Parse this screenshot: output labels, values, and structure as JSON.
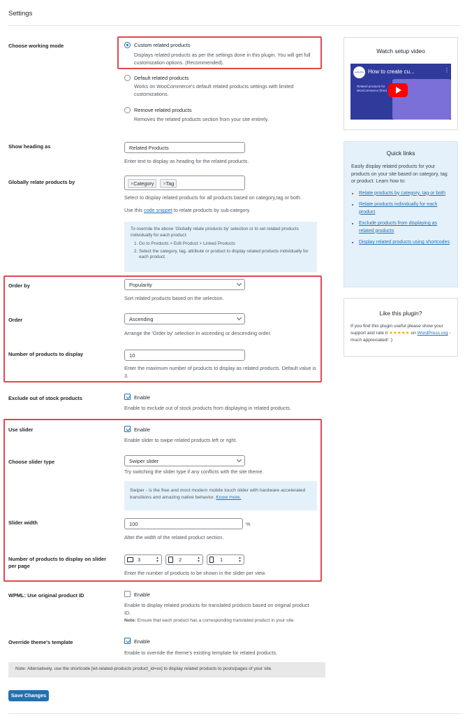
{
  "page": {
    "title": "Settings"
  },
  "working_mode": {
    "label": "Choose working mode",
    "options": [
      {
        "label": "Custom related products",
        "desc": "Displays related products as per the settings done in this plugin. You will get full customization options. (Recommended).",
        "selected": true
      },
      {
        "label": "Default related products",
        "desc": "Works on WooCommerce's default related products settings with limited customizations.",
        "selected": false
      },
      {
        "label": "Remove related products",
        "desc": "Removes the related products section from your site entirely.",
        "selected": false
      }
    ]
  },
  "heading": {
    "label": "Show heading as",
    "value": "Related Products",
    "desc": "Enter text to display as heading for the related products."
  },
  "relate_by": {
    "label": "Globally relate products by",
    "tags": [
      "Category",
      "Tag"
    ],
    "desc": "Select to display related products for all products based on category,tag or both.",
    "snippet_prefix": "Use this",
    "snippet_link": "code snippet",
    "snippet_suffix": "to relate products by sub-category.",
    "info_intro": "To override the above 'Globally relate products by' selection or to set related products individually for each product:",
    "info_steps": [
      "Go to Products > Edit Product > Linked Products",
      "Select the category, tag, attribute or product to display related products individually for each product."
    ]
  },
  "order_by": {
    "label": "Order by",
    "value": "Popularity",
    "desc": "Sort related products based on the selection."
  },
  "order": {
    "label": "Order",
    "value": "Ascending",
    "desc": "Arrange the 'Order by' selection in ascending or descending order."
  },
  "num_products": {
    "label": "Number of products to display",
    "value": "10",
    "desc": "Enter the maximum number of products to display as related products. Default value is 3."
  },
  "exclude_oos": {
    "label": "Exclude out of stock products",
    "check_label": "Enable",
    "checked": true,
    "desc": "Enable to exclude out of stock products from displaying in related products."
  },
  "use_slider": {
    "label": "Use slider",
    "check_label": "Enable",
    "checked": true,
    "desc": "Enable slider to swipe related products left or right."
  },
  "slider_type": {
    "label": "Choose slider type",
    "value": "Swiper slider",
    "desc": "Try switching the slider type if any conflicts with the site theme.",
    "info": "Swiper - is the free and most modern mobile touch slider with hardware accelerated transitions and amazing native behavior.",
    "info_link": "Know more."
  },
  "slider_width": {
    "label": "Slider width",
    "value": "100",
    "unit": "%",
    "desc": "Alter the width of the related product section."
  },
  "slider_per_page": {
    "label": "Number of products to display on slider per page",
    "desktop": "3",
    "tablet": "2",
    "mobile": "1",
    "desc": "Enter the number of products to be shown in the slider per view."
  },
  "wpml": {
    "label": "WPML: Use original product ID",
    "check_label": "Enable",
    "checked": false,
    "desc": "Enable to display related products for translated products based on original product ID.",
    "note_bold": "Note:",
    "note": "Ensure that each product has a corresponding translated product in your site."
  },
  "override_template": {
    "label": "Override theme's template",
    "check_label": "Enable",
    "checked": true,
    "desc": "Enable to override the theme's existing template for related products."
  },
  "shortcode_note": "Note: Alternatively, use the shortcode [wt-related-products product_id=xx] to display related products to posts/pages of your site.",
  "save_button": "Save Changes",
  "sidebar": {
    "video": {
      "title": "Watch setup video",
      "video_title": "How to create cu...",
      "thumb_text": "Related products for WooCommerce (free)",
      "logo_text": "webtoffee"
    },
    "quick_links": {
      "title": "Quick links",
      "intro": "Easily display related products for your products on your site based on category, tag or product. Learn how to:",
      "items": [
        "Relate products by category, tag or both",
        "Relate products individually for each product",
        "Exclude products from displaying as related products",
        "Display related products using shortcodes"
      ]
    },
    "like": {
      "title": "Like this plugin?",
      "text1": "If you find this plugin useful please show your support and rate it",
      "stars": "★★★★★",
      "text2": "on",
      "link": "WordPress.org",
      "text3": "- much appreciated! :)"
    }
  },
  "colors": {
    "accent": "#2271b1",
    "highlight_border": "#e0484f",
    "info_bg": "#e5f1fa"
  }
}
